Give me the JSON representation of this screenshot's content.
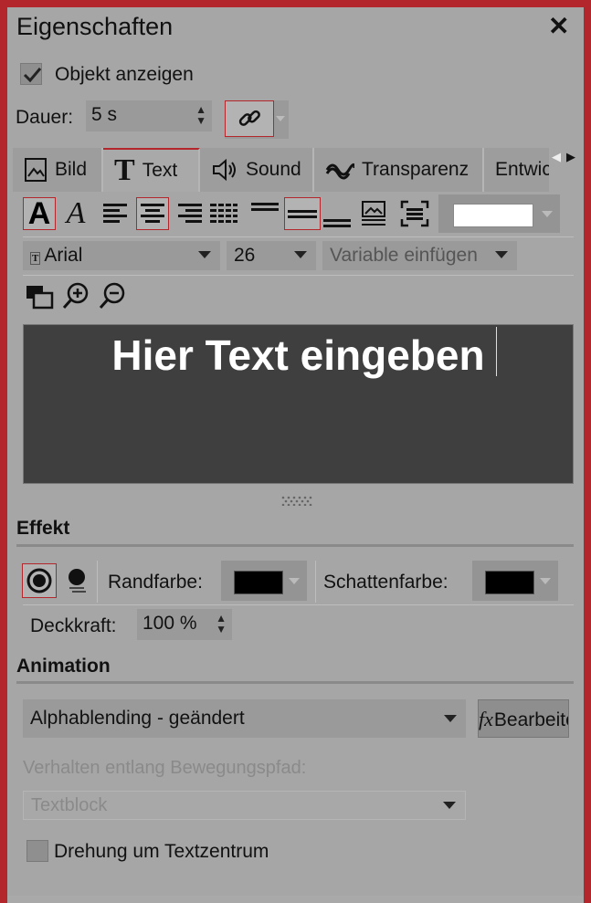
{
  "panel": {
    "title": "Eigenschaften"
  },
  "show_object": {
    "label": "Objekt anzeigen",
    "checked": true
  },
  "duration": {
    "label": "Dauer:",
    "value": "5 s"
  },
  "tabs": [
    {
      "label": "Bild",
      "icon": "image-icon"
    },
    {
      "label": "Text",
      "icon": "text-icon"
    },
    {
      "label": "Sound",
      "icon": "speaker-icon"
    },
    {
      "label": "Transparenz",
      "icon": "wave-icon"
    },
    {
      "label": "Entwic",
      "icon": ""
    }
  ],
  "font": {
    "family": "Arial",
    "size": "26",
    "variable": "Variable einfügen"
  },
  "editor": {
    "text": "Hier Text eingeben"
  },
  "effect": {
    "heading": "Effekt",
    "border_color_label": "Randfarbe:",
    "shadow_color_label": "Schattenfarbe:",
    "opacity_label": "Deckkraft:",
    "opacity_value": "100 %"
  },
  "animation": {
    "heading": "Animation",
    "selected": "Alphablending - geändert",
    "edit_label": "Bearbeiten",
    "path_label": "Verhalten entlang Bewegungspfad:",
    "path_value": "Textblock",
    "rotate_label": "Drehung um Textzentrum"
  },
  "colors": {
    "accent": "#b3262b",
    "editor_bg": "#3f3f3f",
    "panel_bg": "#a6a6a6"
  }
}
